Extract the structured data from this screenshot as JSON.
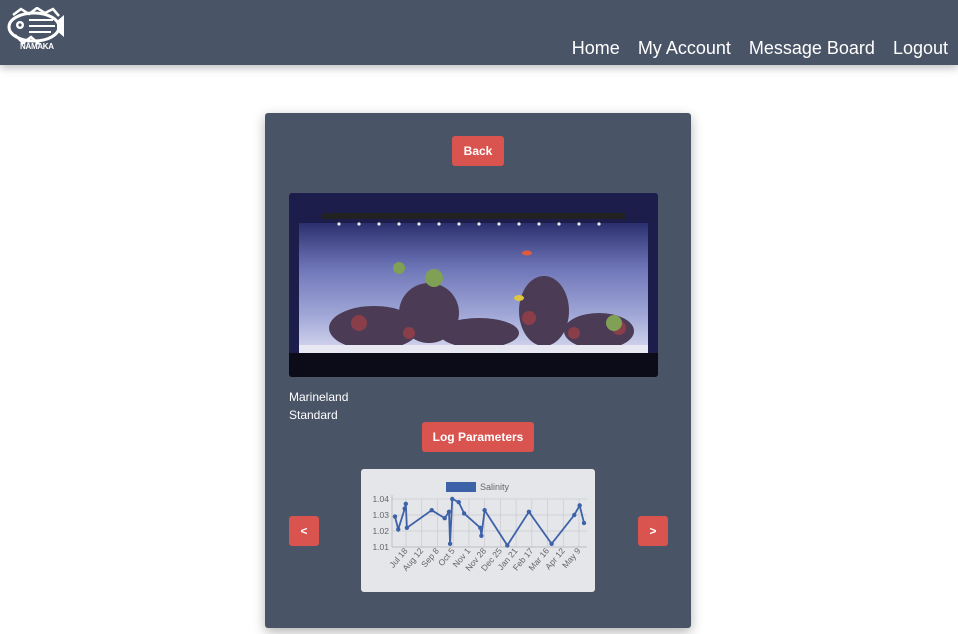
{
  "header": {
    "logo_text": "NĀMAKA",
    "nav": {
      "home": "Home",
      "account": "My Account",
      "board": "Message Board",
      "logout": "Logout"
    }
  },
  "card": {
    "back_label": "Back",
    "tank_name": "Marineland",
    "tank_size": "Standard",
    "log_label": "Log Parameters",
    "prev_label": "<",
    "next_label": ">"
  },
  "chart_data": {
    "type": "line",
    "series": [
      {
        "name": "Salinity",
        "color": "#3e62a8",
        "values": [
          1.029,
          1.021,
          1.034,
          1.037,
          1.022,
          1.033,
          1.028,
          1.032,
          1.012,
          1.04,
          1.038,
          1.031,
          1.022,
          1.017,
          1.033,
          1.011,
          1.032,
          1.012,
          1.03,
          1.036,
          1.025
        ]
      }
    ],
    "x_tick_labels": [
      "Jul 18",
      "Aug 12",
      "Sep 8",
      "Oct 5",
      "Nov 1",
      "Nov 28",
      "Dec 25",
      "Jan 21",
      "Feb 17",
      "Mar 16",
      "Apr 12",
      "May 9"
    ],
    "x_positions": [
      0,
      3,
      9,
      10,
      11,
      34,
      46,
      50,
      51,
      53,
      59,
      64,
      79,
      80,
      83,
      104,
      124,
      145,
      166,
      171,
      175
    ],
    "x_span": 175,
    "y_tick_labels": [
      "1.04",
      "1.03",
      "1.02",
      "1.01"
    ],
    "y_ticks": [
      1.04,
      1.03,
      1.02,
      1.01
    ],
    "ylim": [
      1.01,
      1.04
    ],
    "grid": true,
    "legend_position": "top"
  }
}
